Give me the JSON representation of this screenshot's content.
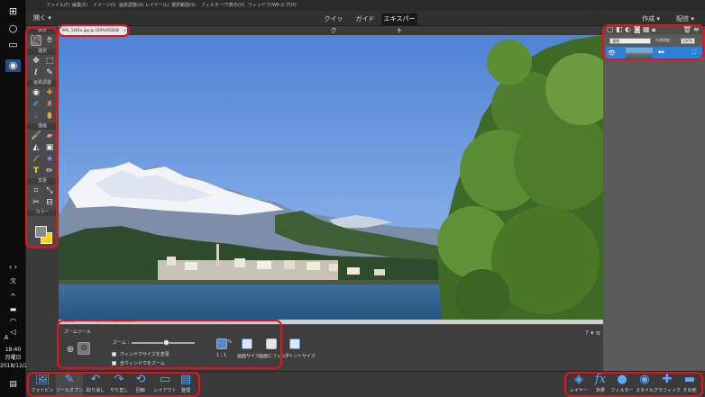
{
  "os": {
    "time": "18:40",
    "weekday": "月曜日",
    "date": "2018/12/24"
  },
  "menubar": [
    "ファイル(F)",
    "編集(E)",
    "イメージ(I)",
    "画質調整(A)",
    "レイヤー(L)",
    "選択範囲(S)",
    "フィルター(T)",
    "表示(V)",
    "ウィンドウ(W)",
    "ヘルプ(H)"
  ],
  "modes": {
    "open": "開く",
    "quick": "クイック",
    "guide": "ガイド",
    "expert": "エキスパート",
    "create": "作成",
    "share": "配信"
  },
  "toolbox": {
    "view": "表示",
    "select": "選択",
    "enhance": "画質調整",
    "draw": "描画",
    "modify": "変更",
    "color": "カラー"
  },
  "document": {
    "tab_label": "IMG_1401a.jpg @ 100%(RGB/8)",
    "close": "×"
  },
  "statusbar": {
    "zoom": "100%",
    "file_info": "ファイル : 1.29M/1.29M"
  },
  "tool_options": {
    "tool_name": "ズームツール",
    "zoom_label": "ズーム :",
    "zoom_value": "100%",
    "fit_window": "ウィンドウサイズを変更",
    "all_windows": "全ウィンドウをズーム",
    "btn_1_1": "1 : 1",
    "btn_screen": "画面サイズ",
    "btn_fit": "画面にフィット",
    "btn_print": "プリントサイズ"
  },
  "layers_panel": {
    "blend_mode": "通常",
    "opacity_label": "不透明度 :",
    "opacity_value": "100%"
  },
  "bottom_left": [
    {
      "label": "フォトビン",
      "icon": "photo-bin-icon"
    },
    {
      "label": "ツールオプシ...",
      "icon": "tool-options-icon"
    },
    {
      "label": "取り消し",
      "icon": "undo-icon"
    },
    {
      "label": "やり直し",
      "icon": "redo-icon"
    },
    {
      "label": "回転",
      "icon": "rotate-icon"
    },
    {
      "label": "レイアウト",
      "icon": "layout-icon"
    },
    {
      "label": "整理",
      "icon": "organizer-icon"
    }
  ],
  "bottom_right": [
    {
      "label": "レイヤー",
      "icon": "layers-icon"
    },
    {
      "label": "効果",
      "icon": "effects-icon"
    },
    {
      "label": "フィルター",
      "icon": "filters-icon"
    },
    {
      "label": "スタイル",
      "icon": "styles-icon"
    },
    {
      "label": "グラフィック",
      "icon": "graphics-icon"
    },
    {
      "label": "その他",
      "icon": "more-icon"
    }
  ],
  "colors": {
    "highlight": "#e8121e",
    "accent": "#2e7fd6",
    "foreground_swatch": "#8a8a8a",
    "background_swatch": "#ffd200"
  }
}
